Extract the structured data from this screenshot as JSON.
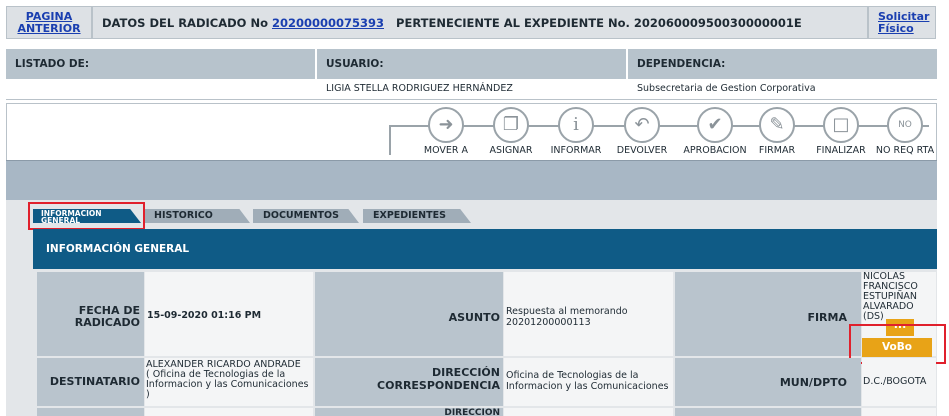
{
  "header": {
    "back_link_line1": "PAGINA",
    "back_link_line2": "ANTERIOR",
    "radicado_prefix": "DATOS DEL RADICADO No",
    "radicado_number": "20200000075393",
    "expediente_text": "PERTENECIENTE AL EXPEDIENTE No. 20206000950030000001E",
    "solicitar_line1": "Solicitar",
    "solicitar_line2": "Físico"
  },
  "info": {
    "listado_label": "LISTADO DE:",
    "usuario_label": "USUARIO:",
    "usuario_value": "LIGIA STELLA RODRIGUEZ HERNÁNDEZ",
    "dependencia_label": "DEPENDENCIA:",
    "dependencia_value": "Subsecretaria de Gestion Corporativa"
  },
  "toolbar": {
    "actions": [
      {
        "label": "MOVER A",
        "icon": "arrow-right-icon"
      },
      {
        "label": "ASIGNAR",
        "icon": "assign-documents-icon"
      },
      {
        "label": "INFORMAR",
        "icon": "info-icon"
      },
      {
        "label": "DEVOLVER",
        "icon": "return-document-icon"
      },
      {
        "label": "APROBACION",
        "icon": "checkmark-icon"
      },
      {
        "label": "FIRMAR",
        "icon": "sign-pen-icon"
      },
      {
        "label": "FINALIZAR",
        "icon": "finalize-document-icon"
      },
      {
        "label": "NO REQ RTA",
        "icon": "no-response-required-icon",
        "badge": "NO"
      }
    ]
  },
  "tabs": {
    "general_line1": "INFORMACION",
    "general_line2": "GENERAL",
    "historico": "HISTORICO",
    "documentos": "DOCUMENTOS",
    "expedientes": "EXPEDIENTES"
  },
  "general": {
    "section_title": "INFORMACIÓN GENERAL",
    "fecha_label_1": "FECHA DE",
    "fecha_label_2": "RADICADO",
    "fecha_value": "15-09-2020 01:16 PM",
    "asunto_label": "ASUNTO",
    "asunto_value_1": "Respuesta al memorando",
    "asunto_value_2": "20201200000113",
    "firma_label": "FIRMA",
    "firma_name_1": "NICOLAS",
    "firma_name_2": "FRANCISCO",
    "firma_name_3": "ESTUPIÑAN",
    "firma_name_4": "ALVARADO",
    "firma_name_5": "(DS)",
    "firma_dots": "...",
    "vobo_label": "VoBo",
    "destinatario_label": "DESTINATARIO",
    "destinatario_value_1": "ALEXANDER RICARDO ANDRADE",
    "destinatario_value_2": "( Oficina de Tecnologias de la",
    "destinatario_value_3": "Informacion y las Comunicaciones",
    "destinatario_value_4": ")",
    "direccion_label_1": "DIRECCIÓN",
    "direccion_label_2": "CORRESPONDENCIA",
    "direccion_value_1": "Oficina de Tecnologias de la",
    "direccion_value_2": "Informacion y las Comunicaciones",
    "mun_label": "MUN/DPTO",
    "mun_value": "D.C./BOGOTA",
    "next_row_label": "DIRECCIÓN"
  },
  "colors": {
    "accent_blue": "#0f5b86",
    "highlight_red": "#e0202c",
    "vobo_orange": "#e8a317"
  }
}
